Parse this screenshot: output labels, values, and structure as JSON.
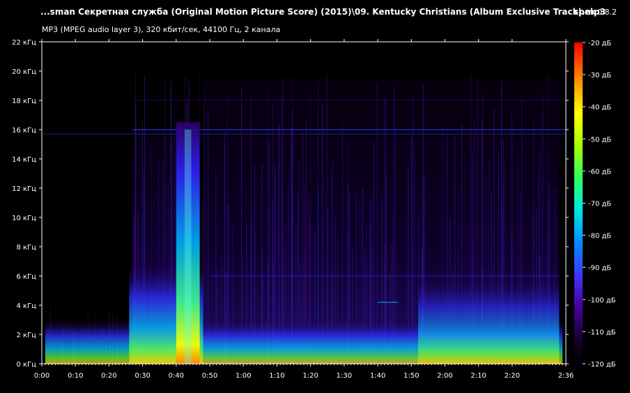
{
  "header": {
    "file_title": "...sman Секретная служба (Original Motion Picture Score) (2015)\\09. Kentucky Christians (Album Exclusive Track).mp3",
    "app_name": "spek",
    "app_version": "0.8.2",
    "stream_info": "MP3 (MPEG audio layer 3), 320 кбит/сек, 44100 Гц, 2 канала"
  },
  "colors": {
    "background": "#000000",
    "axis": "#ffffff",
    "palette": [
      "#000000",
      "#2a0050",
      "#5a00c8",
      "#2a2aff",
      "#00a0ff",
      "#00ffc8",
      "#40ff40",
      "#c8ff00",
      "#ffff00",
      "#ff8000",
      "#ff0000"
    ]
  },
  "chart_data": {
    "type": "heatmap",
    "xlabel": "",
    "ylabel": "",
    "x_range_seconds": [
      0,
      156
    ],
    "y_range_khz": [
      0,
      22
    ],
    "x_ticks": [
      "0:00",
      "0:10",
      "0:20",
      "0:30",
      "0:40",
      "0:50",
      "1:00",
      "1:10",
      "1:20",
      "1:30",
      "1:40",
      "1:50",
      "2:00",
      "2:10",
      "2:20",
      "2:36"
    ],
    "y_ticks": [
      "0 кГц",
      "2 кГц",
      "4 кГц",
      "6 кГц",
      "8 кГц",
      "10 кГц",
      "12 кГц",
      "14 кГц",
      "16 кГц",
      "18 кГц",
      "20 кГц",
      "22 кГц"
    ],
    "color_scale_range_db": [
      -120,
      -20
    ],
    "color_scale_ticks": [
      "-20 дБ",
      "-30 дБ",
      "-40 дБ",
      "-50 дБ",
      "-60 дБ",
      "-70 дБ",
      "-80 дБ",
      "-90 дБ",
      "-100 дБ",
      "-110 дБ",
      "-120 дБ"
    ]
  }
}
